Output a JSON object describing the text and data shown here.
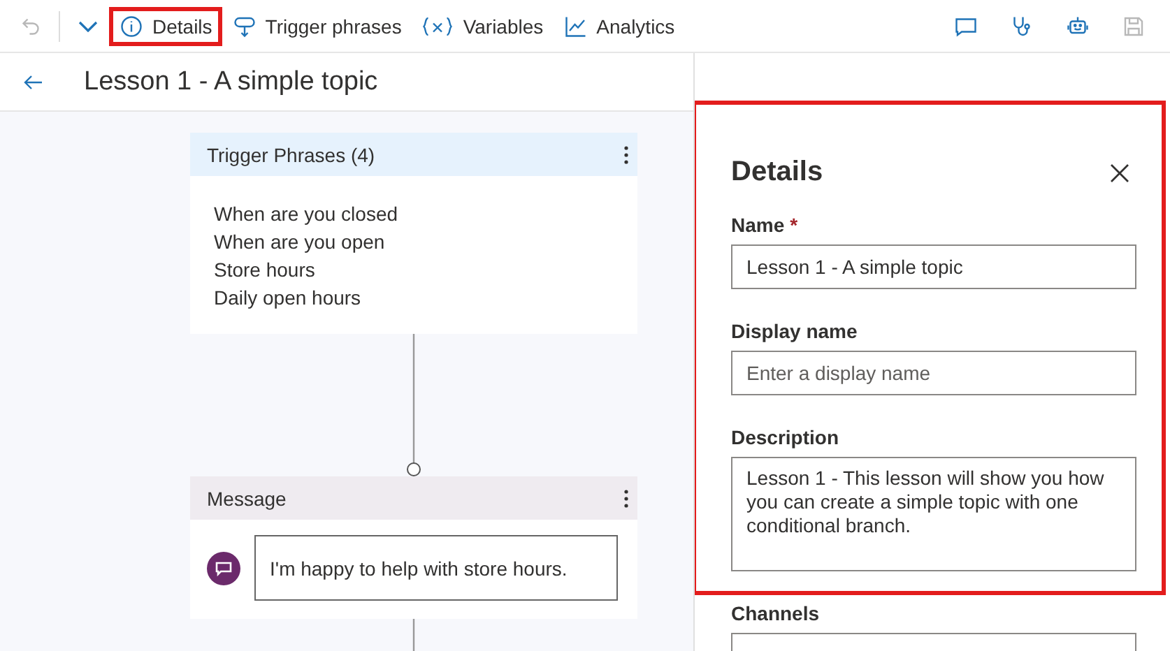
{
  "toolbar": {
    "history": [
      {
        "kind": "undo",
        "disabled": true
      },
      {
        "kind": "dropdown",
        "disabled": false
      }
    ],
    "actions": [
      {
        "kind": "details",
        "label": "Details",
        "highlighted": true
      },
      {
        "kind": "trigger",
        "label": "Trigger phrases",
        "highlighted": false
      },
      {
        "kind": "variables",
        "label": "Variables",
        "highlighted": false
      },
      {
        "kind": "analytics",
        "label": "Analytics",
        "highlighted": false
      }
    ],
    "icons": [
      {
        "kind": "chat",
        "disabled": false
      },
      {
        "kind": "stethoscope",
        "disabled": false
      },
      {
        "kind": "bot",
        "disabled": false
      },
      {
        "kind": "save",
        "disabled": true
      }
    ]
  },
  "header": {
    "title": "Lesson 1 - A simple topic"
  },
  "canvas": {
    "nodes": [
      {
        "kind": "trigger",
        "title": "Trigger Phrases (4)",
        "phrases": [
          "When are you closed",
          "When are you open",
          "Store hours",
          "Daily open hours"
        ]
      },
      {
        "kind": "message",
        "title": "Message",
        "text": "I'm happy to help with store hours."
      }
    ]
  },
  "details_panel": {
    "title": "Details",
    "highlighted": true,
    "fields": [
      {
        "kind": "input",
        "label": "Name",
        "required_mark": "*",
        "value": "Lesson 1 - A simple topic"
      },
      {
        "kind": "input",
        "label": "Display name",
        "placeholder": "Enter a display name"
      },
      {
        "kind": "textarea",
        "label": "Description",
        "value": "Lesson 1 - This lesson will show you how you can create a simple topic with one conditional branch."
      },
      {
        "kind": "select",
        "label": "Channels"
      }
    ]
  }
}
